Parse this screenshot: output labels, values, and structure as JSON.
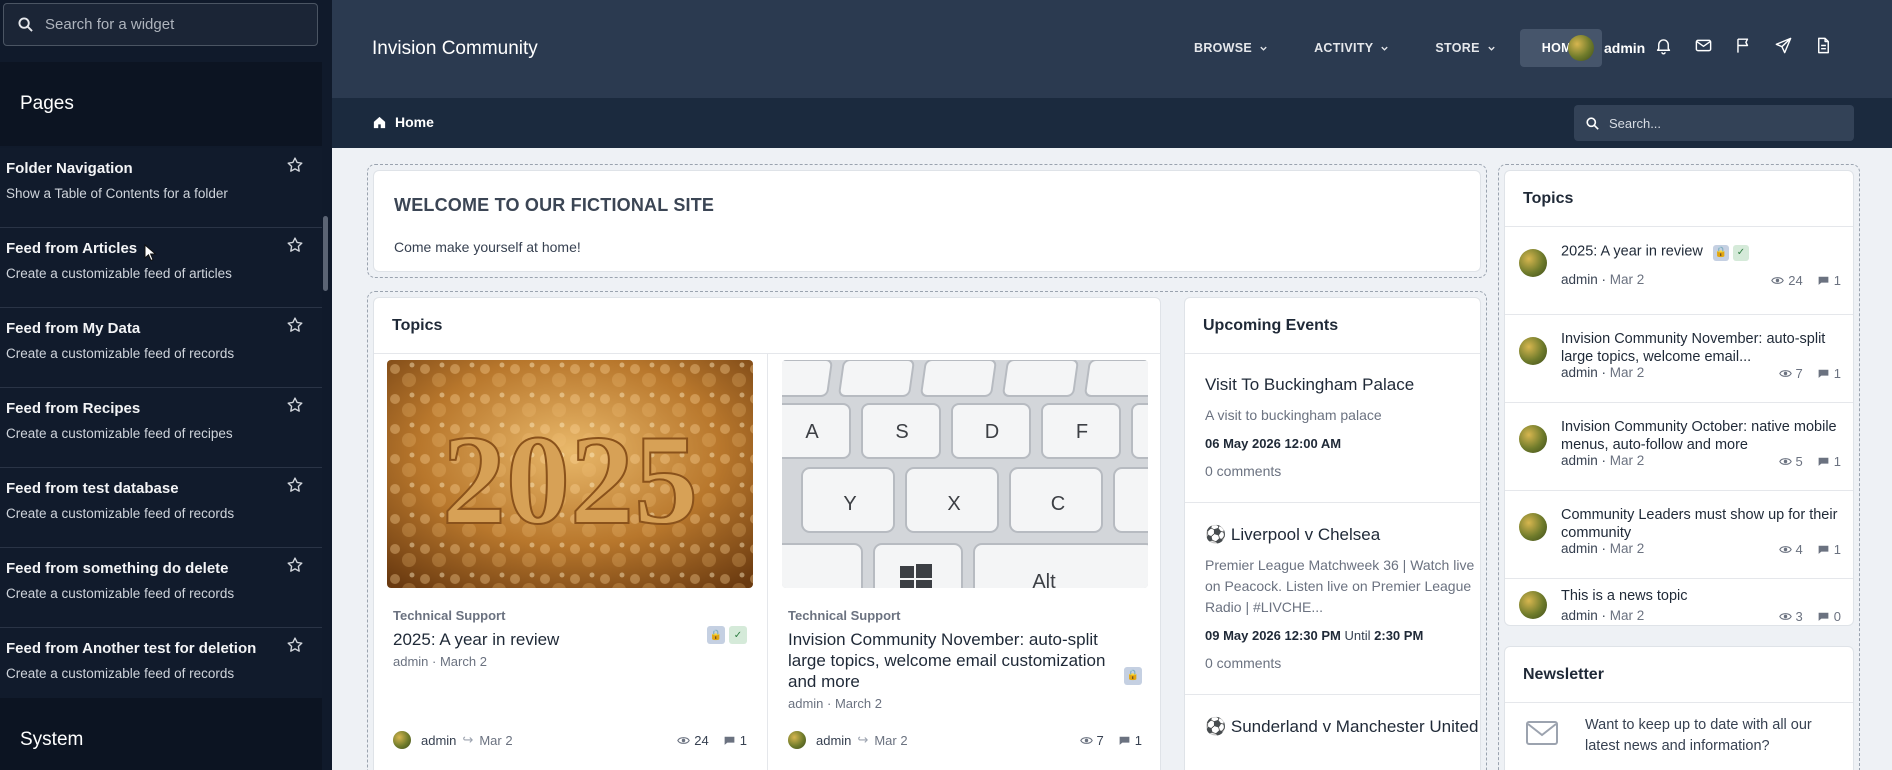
{
  "left_panel": {
    "search_placeholder": "Search for a widget",
    "pages_heading": "Pages",
    "system_heading": "System",
    "widgets": [
      {
        "title": "Folder Navigation",
        "desc": "Show a Table of Contents for a folder"
      },
      {
        "title": "Feed from Articles",
        "desc": "Create a customizable feed of articles"
      },
      {
        "title": "Feed from My Data",
        "desc": "Create a customizable feed of records"
      },
      {
        "title": "Feed from Recipes",
        "desc": "Create a customizable feed of recipes"
      },
      {
        "title": "Feed from test database",
        "desc": "Create a customizable feed of records"
      },
      {
        "title": "Feed from something do delete",
        "desc": "Create a customizable feed of records"
      },
      {
        "title": "Feed from Another test for deletion",
        "desc": "Create a customizable feed of records"
      }
    ]
  },
  "header": {
    "site_title": "Invision Community",
    "nav": [
      {
        "label": "BROWSE",
        "dropdown": true
      },
      {
        "label": "ACTIVITY",
        "dropdown": true
      },
      {
        "label": "STORE",
        "dropdown": true
      },
      {
        "label": "HOME",
        "dropdown": false
      }
    ],
    "user_name": "admin"
  },
  "subheader": {
    "breadcrumb_home": "Home",
    "search_placeholder": "Search..."
  },
  "welcome": {
    "heading": "WELCOME TO OUR FICTIONAL SITE",
    "text": "Come make yourself at home!"
  },
  "topics_main": {
    "heading": "Topics",
    "items": [
      {
        "image_text": "2025",
        "category": "Technical Support",
        "title": "2025: A year in review",
        "meta": "admin · March 2",
        "author": "admin",
        "date": "Mar 2",
        "views": "24",
        "replies": "1"
      },
      {
        "image_text": "",
        "category": "Technical Support",
        "title": "Invision Community November: auto-split large topics, welcome email customization and more",
        "meta": "admin · March 2",
        "author": "admin",
        "date": "Mar 2",
        "views": "7",
        "replies": "1"
      }
    ]
  },
  "events": {
    "heading": "Upcoming Events",
    "items": [
      {
        "title": "Visit To Buckingham Palace",
        "desc": "A visit to buckingham palace",
        "date": "06 May 2026 12:00 AM",
        "until": "",
        "until_time": "",
        "comments": "0 comments"
      },
      {
        "title": "⚽ Liverpool v Chelsea",
        "desc": "Premier League Matchweek 36 | Watch live on Peacock. Listen live on Premier League Radio | #LIVCHE...",
        "date": "09 May 2026 12:30 PM",
        "until": "Until",
        "until_time": "2:30 PM",
        "comments": "0 comments"
      },
      {
        "title": "⚽ Sunderland v Manchester United",
        "desc": "",
        "date": "",
        "until": "",
        "until_time": "",
        "comments": ""
      }
    ]
  },
  "topics_side": {
    "heading": "Topics",
    "items": [
      {
        "title": "2025: A year in review",
        "author": "admin",
        "date": "Mar 2",
        "views": "24",
        "replies": "1"
      },
      {
        "title": "Invision Community November: auto-split large topics, welcome email...",
        "author": "admin",
        "date": "Mar 2",
        "views": "7",
        "replies": "1"
      },
      {
        "title": "Invision Community October: native mobile menus, auto-follow and more",
        "author": "admin",
        "date": "Mar 2",
        "views": "5",
        "replies": "1"
      },
      {
        "title": "Community Leaders must show up for their community",
        "author": "admin",
        "date": "Mar 2",
        "views": "4",
        "replies": "1"
      },
      {
        "title": "This is a news topic",
        "author": "admin",
        "date": "Mar 2",
        "views": "3",
        "replies": "0"
      }
    ]
  },
  "newsletter": {
    "heading": "Newsletter",
    "text": "Want to keep up to date with all our latest news and information?"
  },
  "colors": {
    "header_bg": "#2b3a50",
    "subheader_bg": "#1b2a3e",
    "panel_bg": "#101a2b",
    "page_bg": "#eef1f5"
  }
}
